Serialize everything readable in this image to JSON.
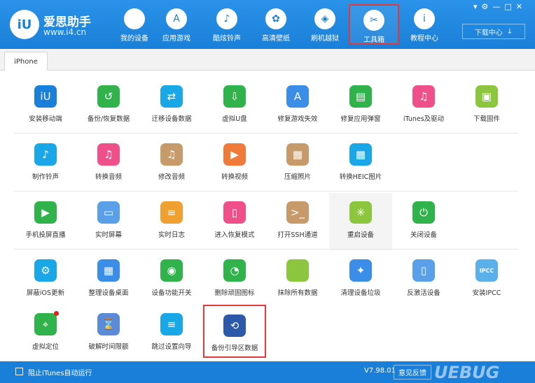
{
  "app": {
    "logo_badge": "iU",
    "title": "爱思助手",
    "url": "www.i4.cn"
  },
  "nav": [
    {
      "label": "我的设备",
      "icon": "apple-icon",
      "glyph": ""
    },
    {
      "label": "应用游戏",
      "icon": "app-store-icon",
      "glyph": "A"
    },
    {
      "label": "酷炫铃声",
      "icon": "bell-icon",
      "glyph": "♪"
    },
    {
      "label": "高清壁纸",
      "icon": "flower-icon",
      "glyph": "✿"
    },
    {
      "label": "刷机越狱",
      "icon": "box-icon",
      "glyph": "◈"
    },
    {
      "label": "工具箱",
      "icon": "tools-icon",
      "glyph": "✂"
    },
    {
      "label": "教程中心",
      "icon": "info-icon",
      "glyph": "i"
    }
  ],
  "download": {
    "label": "下载中心",
    "arrow": "↓"
  },
  "window_controls": [
    "▾",
    "⚙",
    "—",
    "□",
    "✕"
  ],
  "tab": {
    "label": "iPhone"
  },
  "tools": {
    "row1": [
      {
        "label": "安装移动端",
        "icon": "i4-logo-icon",
        "glyph": "iU",
        "color": "#1a7fd8"
      },
      {
        "label": "备份/恢复数据",
        "icon": "backup-clock-icon",
        "glyph": "↺",
        "color": "#2fb34a"
      },
      {
        "label": "迁移设备数据",
        "icon": "migrate-icon",
        "glyph": "⇄",
        "color": "#1aa7e8"
      },
      {
        "label": "虚拟U盘",
        "icon": "usb-icon",
        "glyph": "⇩",
        "color": "#2fb34a"
      },
      {
        "label": "修复游戏失效",
        "icon": "app-store-icon",
        "glyph": "A",
        "color": "#3b8ee8"
      },
      {
        "label": "修复应用弹窗",
        "icon": "apple-id-icon",
        "glyph": "▤",
        "color": "#2fb34a"
      },
      {
        "label": "iTunes及驱动",
        "icon": "music-icon",
        "glyph": "♫",
        "color": "#f0508a"
      },
      {
        "label": "下载固件",
        "icon": "cube-icon",
        "glyph": "▣",
        "color": "#8cc63f"
      }
    ],
    "row2": [
      {
        "label": "制作铃声",
        "icon": "bell-icon",
        "glyph": "♪",
        "color": "#1aa7e8"
      },
      {
        "label": "转换音频",
        "icon": "music-icon",
        "glyph": "♫",
        "color": "#f0508a"
      },
      {
        "label": "修改音频",
        "icon": "music-edit-icon",
        "glyph": "♫",
        "color": "#c79a6a"
      },
      {
        "label": "转换视频",
        "icon": "play-icon",
        "glyph": "▶",
        "color": "#f07a3a"
      },
      {
        "label": "压缩照片",
        "icon": "image-icon",
        "glyph": "▦",
        "color": "#c79a6a"
      },
      {
        "label": "转换HEIC图片",
        "icon": "heic-image-icon",
        "glyph": "▦",
        "color": "#1aa7e8"
      }
    ],
    "row3": [
      {
        "label": "手机投屏直播",
        "icon": "screen-cast-icon",
        "glyph": "▶",
        "color": "#2fb34a"
      },
      {
        "label": "实时屏幕",
        "icon": "monitor-icon",
        "glyph": "▭",
        "color": "#5aa0e8"
      },
      {
        "label": "实时日志",
        "icon": "log-icon",
        "glyph": "≡",
        "color": "#f0a030"
      },
      {
        "label": "进入恢复模式",
        "icon": "phone-icon",
        "glyph": "▯",
        "color": "#f0508a"
      },
      {
        "label": "打开SSH通道",
        "icon": "terminal-icon",
        "glyph": ">_",
        "color": "#c79a6a"
      },
      {
        "label": "重启设备",
        "icon": "restart-icon",
        "glyph": "✳",
        "color": "#8cc63f"
      },
      {
        "label": "关闭设备",
        "icon": "power-icon",
        "glyph": "⏻",
        "color": "#2fb34a"
      }
    ],
    "row4": [
      {
        "label": "屏蔽iOS更新",
        "icon": "gear-icon",
        "glyph": "⚙",
        "color": "#1aa7e8"
      },
      {
        "label": "整理设备桌面",
        "icon": "grid-icon",
        "glyph": "▦",
        "color": "#3b8ee8"
      },
      {
        "label": "设备功能开关",
        "icon": "toggle-icon",
        "glyph": "◉",
        "color": "#2fb34a"
      },
      {
        "label": "删除顽固图标",
        "icon": "pie-icon",
        "glyph": "◔",
        "color": "#2fb34a"
      },
      {
        "label": "抹除所有数据",
        "icon": "apple-icon",
        "glyph": "",
        "color": "#8cc63f"
      },
      {
        "label": "清理设备垃圾",
        "icon": "broom-icon",
        "glyph": "✦",
        "color": "#3b8ee8"
      },
      {
        "label": "反激活设备",
        "icon": "deactivate-icon",
        "glyph": "▯",
        "color": "#5aa0e8"
      },
      {
        "label": "安装IPCC",
        "icon": "ipcc-icon",
        "glyph": "IPCC",
        "color": "#5ab0e8"
      }
    ],
    "row5": [
      {
        "label": "虚拟定位",
        "icon": "location-pin-icon",
        "glyph": "⌖",
        "color": "#2fb34a"
      },
      {
        "label": "破解时间限额",
        "icon": "hourglass-icon",
        "glyph": "⌛",
        "color": "#5a8ad8"
      },
      {
        "label": "跳过设置向导",
        "icon": "skip-wizard-icon",
        "glyph": "≡",
        "color": "#1aa7e8"
      },
      {
        "label": "备份引导区数据",
        "icon": "boot-backup-icon",
        "glyph": "⟲",
        "color": "#2a5aa8"
      }
    ]
  },
  "footer": {
    "checkbox_label": "阻止iTunes自动运行",
    "version": "V7.98.01",
    "feedback": "意见反馈",
    "watermark": "UEBUG"
  }
}
